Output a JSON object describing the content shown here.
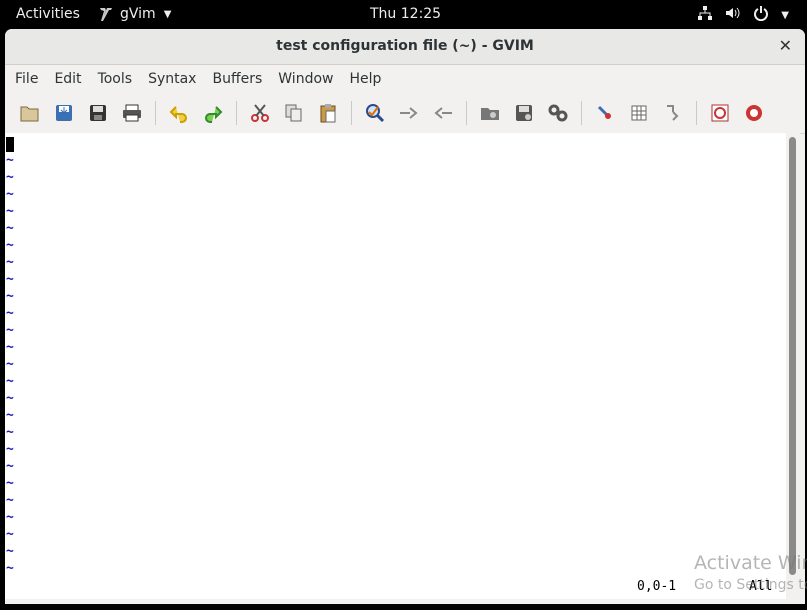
{
  "topbar": {
    "activities": "Activities",
    "app_name": "gVim",
    "clock": "Thu 12:25"
  },
  "window": {
    "title": "test configuration file (~) - GVIM",
    "close_glyph": "✕"
  },
  "menu": [
    "File",
    "Edit",
    "Tools",
    "Syntax",
    "Buffers",
    "Window",
    "Help"
  ],
  "toolbar_icons": [
    "open-file-icon",
    "save-file-icon",
    "save-all-icon",
    "print-icon",
    "undo-icon",
    "redo-icon",
    "cut-icon",
    "copy-icon",
    "paste-icon",
    "find-replace-icon",
    "find-next-icon",
    "find-previous-icon",
    "load-session-icon",
    "save-session-icon",
    "run-script-icon",
    "make-icon",
    "build-tags-icon",
    "jump-to-tag-icon",
    "help-icon",
    "find-help-icon"
  ],
  "editor": {
    "tilde": "~",
    "tilde_count": 25,
    "cursor_pos": "0,0-1",
    "scroll_pos": "All"
  },
  "watermark": {
    "line1": "Activate Win",
    "line2": "Go to Settings to"
  }
}
